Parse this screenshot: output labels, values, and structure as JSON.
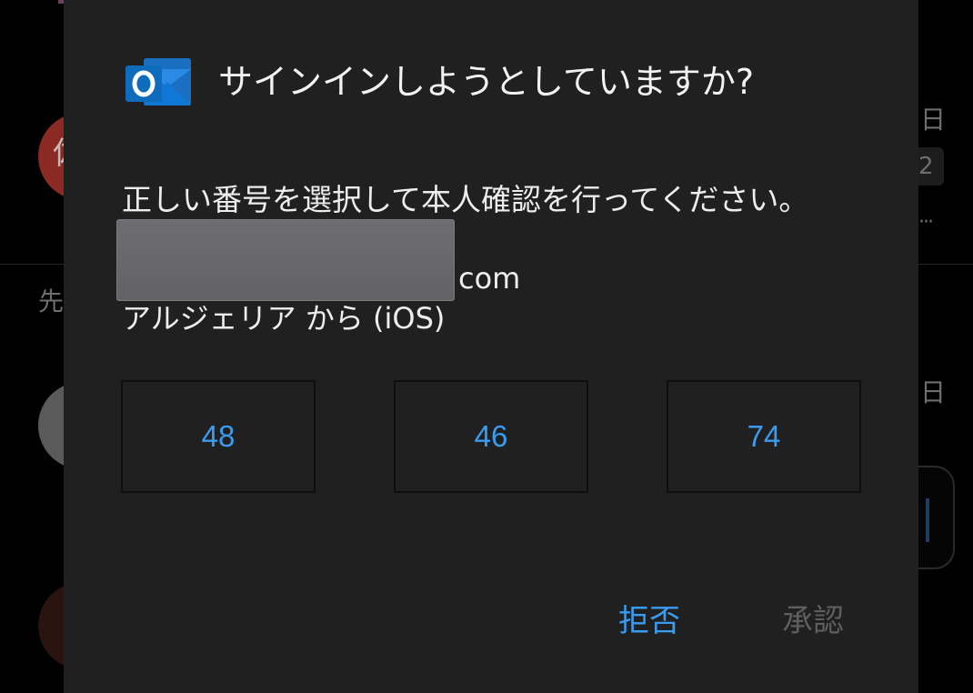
{
  "background": {
    "avatar_initial": "佐",
    "date_label_1": "日",
    "badge_count": "2",
    "more_dots": "···",
    "section_label": "先",
    "date_label_2": "日"
  },
  "dialog": {
    "app_icon": "outlook-icon",
    "title": "サインインしようとしていますか?",
    "instruction": "正しい番号を選択して本人確認を行ってください。",
    "email_suffix": "com",
    "location": "アルジェリア から (iOS)",
    "numbers": [
      "48",
      "46",
      "74"
    ],
    "deny_label": "拒否",
    "approve_label": "承認"
  },
  "colors": {
    "accent": "#3a9cf0",
    "dialog_bg": "#202020",
    "outlook_blue": "#0f78d4",
    "disabled": "#5e5e5e"
  }
}
